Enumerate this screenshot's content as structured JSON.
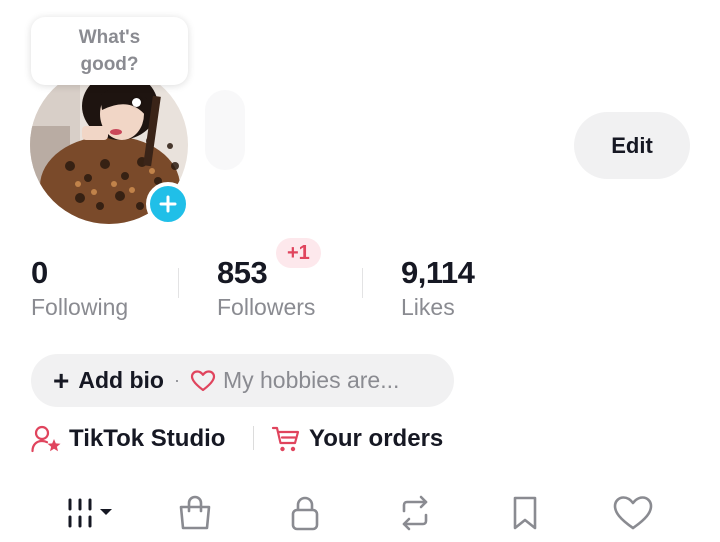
{
  "bubble": {
    "text": "What's good?"
  },
  "profile": {
    "edit_label": "Edit"
  },
  "stats": {
    "following": {
      "value": "0",
      "label": "Following"
    },
    "followers": {
      "value": "853",
      "label": "Followers",
      "badge": "+1"
    },
    "likes": {
      "value": "9,114",
      "label": "Likes"
    }
  },
  "bio": {
    "add_label": "Add bio",
    "separator": "·",
    "hobby_placeholder": "My hobbies are..."
  },
  "links": {
    "studio": "TikTok Studio",
    "orders": "Your orders"
  },
  "tabs": [
    {
      "icon": "grid-icon"
    },
    {
      "icon": "shopping-bag-icon"
    },
    {
      "icon": "lock-icon"
    },
    {
      "icon": "repost-icon"
    },
    {
      "icon": "bookmark-icon"
    },
    {
      "icon": "heart-icon"
    }
  ],
  "colors": {
    "accent_cyan": "#20bfe8",
    "accent_red": "#e0445d",
    "pill_bg": "#f1f1f2",
    "text_primary": "#161823",
    "text_secondary": "#8a8b91"
  }
}
